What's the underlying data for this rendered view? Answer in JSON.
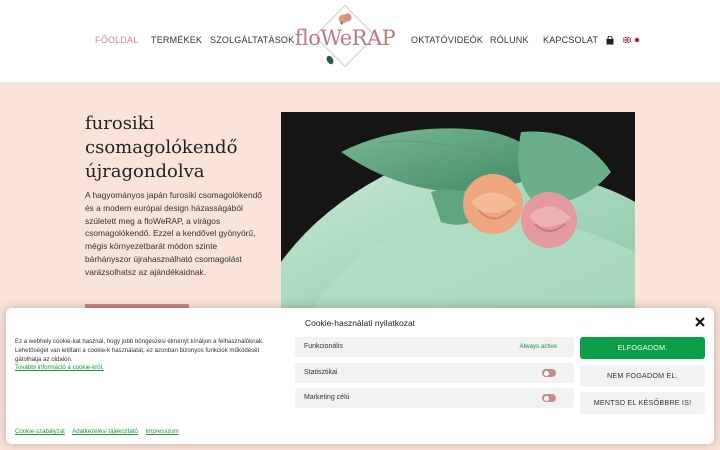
{
  "nav": {
    "items": [
      {
        "label": "FŐOLDAL",
        "active": true
      },
      {
        "label": "TERMÉKEK"
      },
      {
        "label": "SZOLGÁLTATÁSOK"
      },
      {
        "label": "OKTATÓVIDEÓK"
      },
      {
        "label": "RÓLUNK"
      },
      {
        "label": "KAPCSOLAT"
      }
    ],
    "logo_text": "floWeRAP"
  },
  "hero": {
    "title": "furosiki csomagolókendő újragondolva",
    "text": "A hagyományos japán furosiki csomagolókendő és a modern európai design házasságából született meg a floWeRAP, a virágos csomagolókendő. Ezzel a kendővel gyönyörű, mégis környezetbarát módon szinte bárhányszor újrahasználható csomagolást varázsolhatsz az ajándékaidnak."
  },
  "cookie": {
    "title": "Cookie-használati nyilatkozat",
    "description": "Ez a webhely cookie-kat használ, hogy jobb böngészési élményt kínáljon a felhasználóknak. Lehetőséget van letiltani a cookie-k használatát, ez azonban bizonyos funkciók működését gátolhatja az oldalon.",
    "more_link": "További információ a cookie-król.",
    "categories": [
      {
        "label": "Funkcionális",
        "status": "Always active"
      },
      {
        "label": "Statisztikai"
      },
      {
        "label": "Marketing célú"
      }
    ],
    "buttons": {
      "accept": "ELFOGADOM.",
      "deny": "NEM FOGADOM EL.",
      "save": "MENTSD EL KÉSŐBBRE IS!"
    },
    "links": [
      "Cookie-szabályzat",
      "Adatkezelési tájékoztató",
      "Impresszum"
    ]
  },
  "colors": {
    "accent": "#c98a8c",
    "background": "#fae3d9",
    "accept_green": "#0b9e47"
  }
}
